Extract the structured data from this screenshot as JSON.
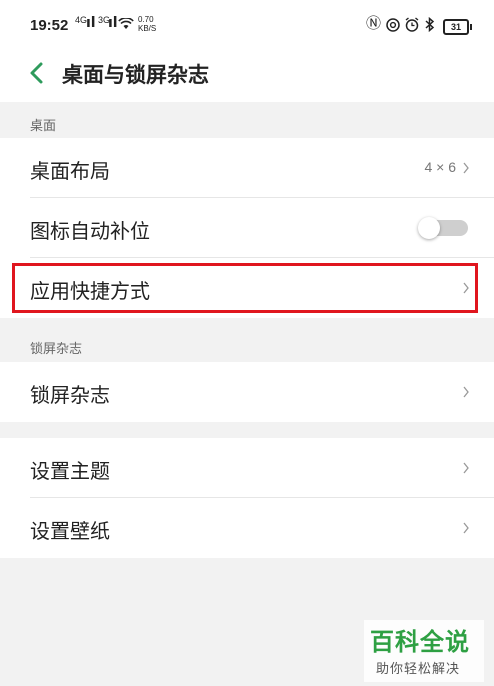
{
  "status_bar": {
    "time": "19:52",
    "sig1_label": "4G",
    "sig1_bars": "ıl",
    "sig2_label": "3G",
    "sig2_bars": "ıl",
    "speed_value": "0.70",
    "speed_unit": "KB/S",
    "nfc_glyph": "Ⓝ",
    "battery": "31"
  },
  "header": {
    "title": "桌面与锁屏杂志"
  },
  "sections": {
    "desktop": {
      "header": "桌面",
      "layout_label": "桌面布局",
      "layout_value": "4 × 6",
      "auto_fill_label": "图标自动补位",
      "auto_fill_on": false,
      "shortcut_label": "应用快捷方式"
    },
    "lock": {
      "header": "锁屏杂志",
      "magazine_label": "锁屏杂志"
    },
    "misc": {
      "theme_label": "设置主题",
      "wallpaper_label": "设置壁纸"
    }
  },
  "watermark": {
    "title": "百科全说",
    "subtitle": "助你轻松解决"
  },
  "colors": {
    "accent": "#2e9b5c",
    "highlight": "#e0161e",
    "toggle_off": "#cfcfcf"
  }
}
